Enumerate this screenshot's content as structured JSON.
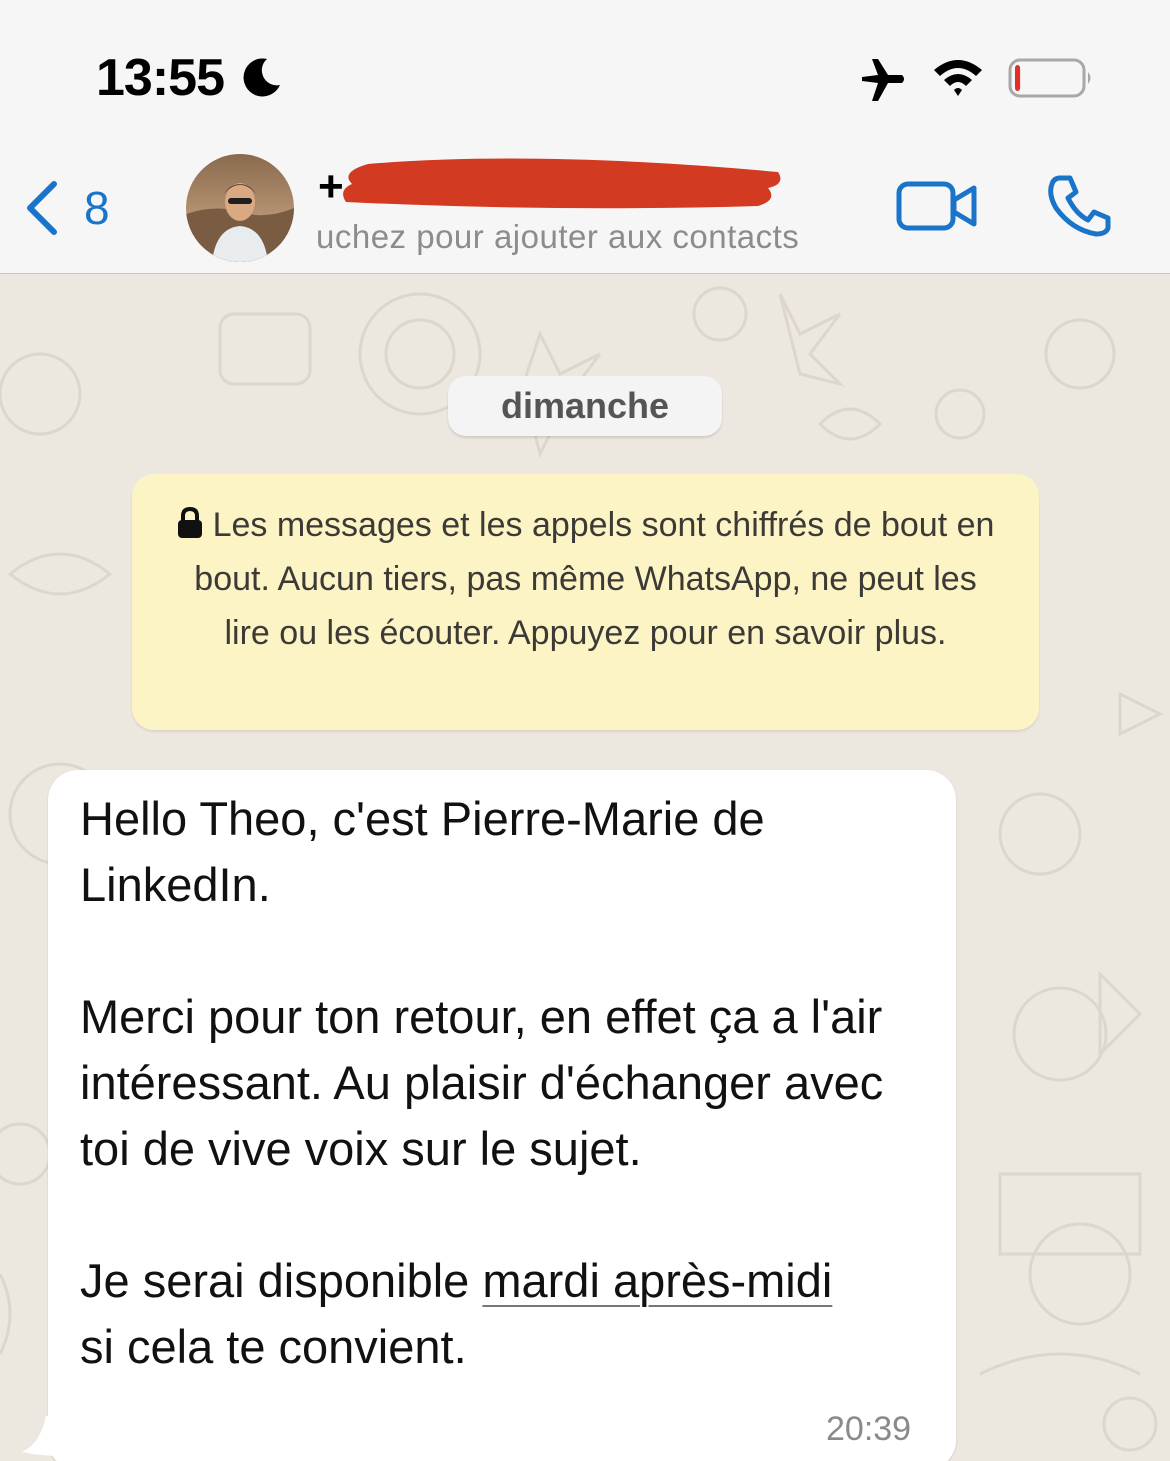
{
  "status_bar": {
    "time": "13:55",
    "icons": [
      "moon-icon",
      "airplane-icon",
      "wifi-icon",
      "battery-icon"
    ],
    "battery_level_fraction": 0.08
  },
  "header": {
    "back_count": "8",
    "contact_number_prefix": "+",
    "subtitle": "uchez pour ajouter aux contacts",
    "accent_color": "#1a74c9",
    "redaction_color": "#d33a22"
  },
  "chat": {
    "date_label": "dimanche",
    "encryption_notice": "Les messages et les appels sont chiffrés de bout en bout. Aucun tiers, pas même WhatsApp, ne peut les lire ou les écouter. Appuyez pour en savoir plus.",
    "message": {
      "text_before": "Hello Theo, c'est Pierre-Marie de LinkedIn.\n\nMerci pour ton retour, en effet ça a l'air intéressant. Au plaisir d'échanger avec toi de vive voix sur le sujet.\n\nJe serai disponible ",
      "link_text": "mardi après-midi",
      "text_after": "\nsi cela te convient.",
      "time": "20:39"
    }
  }
}
